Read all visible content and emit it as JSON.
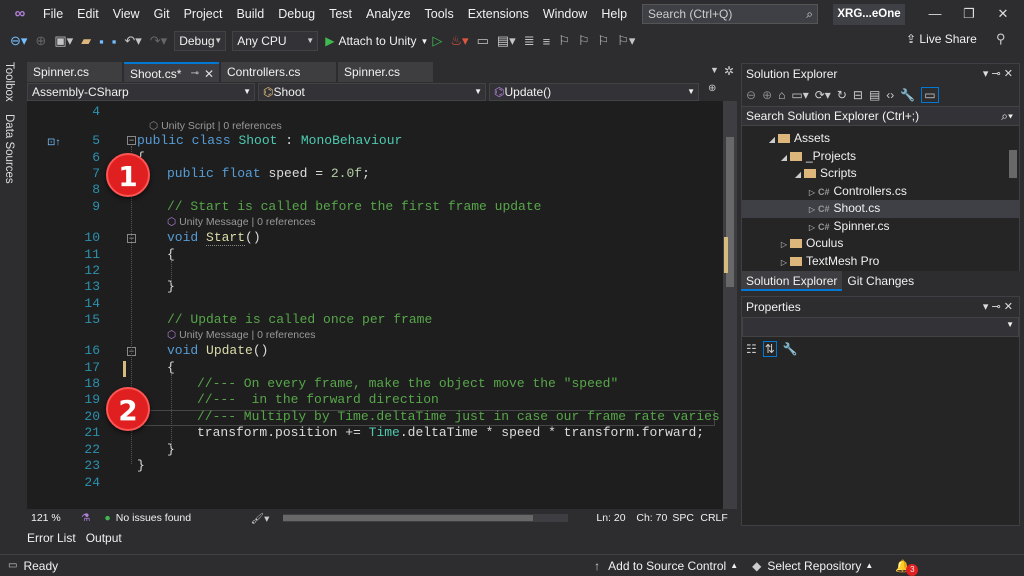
{
  "menu": [
    "File",
    "Edit",
    "View",
    "Git",
    "Project",
    "Build",
    "Debug",
    "Test",
    "Analyze",
    "Tools",
    "Extensions",
    "Window",
    "Help"
  ],
  "search": {
    "label": "Search (Ctrl+Q)"
  },
  "app_badge": "XRG...eOne",
  "toolbar": {
    "config": "Debug",
    "platform": "Any CPU",
    "attach": "Attach to Unity",
    "live_share": "Live Share"
  },
  "left_rail": [
    "Toolbox",
    "Data Sources"
  ],
  "doc_tabs": [
    "Spinner.cs",
    "Shoot.cs*",
    "Controllers.cs",
    "Spinner.cs"
  ],
  "navbar": {
    "project": "Assembly-CSharp",
    "class": "Shoot",
    "member": "Update()"
  },
  "code": {
    "n4": "4",
    "n5": "5",
    "n6": "6",
    "n7": "7",
    "n8": "8",
    "n9": "9",
    "n10": "10",
    "n11": "11",
    "n12": "12",
    "n13": "13",
    "n14": "14",
    "n15": "15",
    "n16": "16",
    "n17": "17",
    "n18": "18",
    "n19": "19",
    "n20": "20",
    "n21": "21",
    "n22": "22",
    "n23": "23",
    "n24": "24",
    "lens_class": "Unity Script | 0 references",
    "lens_start": "Unity Message | 0 references",
    "lens_update": "Unity Message | 0 references",
    "public": "public",
    "class": "class",
    "shoot": "Shoot",
    "colon": " : ",
    "mono": "MonoBehaviour",
    "brace_open": "{",
    "brace_close": "}",
    "float": "float",
    "speed_decl": " speed = ",
    "speed_val": "2.0f",
    "semi": ";",
    "c9": "// Start is called before the first frame update",
    "void": "void",
    "start": "Start",
    "parens": "()",
    "c15": "// Update is called once per frame",
    "update": "Update",
    "c18": "//--- On every frame, make the object move the \"speed\"",
    "c19": "//---  in the forward direction",
    "c20": "//--- Multiply by Time.deltaTime just in case our frame rate varies",
    "l21a": "transform.position += ",
    "l21b": "Time",
    "l21c": ".deltaTime * speed * transform.forward;"
  },
  "badges": [
    "1",
    "2"
  ],
  "editor_status": {
    "zoom": "121 %",
    "issues": "No issues found",
    "ln": "Ln: 20",
    "ch": "Ch: 70",
    "spc": "SPC",
    "crlf": "CRLF"
  },
  "bottom_tabs": [
    "Error List",
    "Output"
  ],
  "status": {
    "ready": "Ready",
    "add_source": "Add to Source Control",
    "select_repo": "Select Repository",
    "notif_count": "3"
  },
  "solution": {
    "title": "Solution Explorer",
    "search": "Search Solution Explorer (Ctrl+;)",
    "tree": [
      {
        "label": "Assets",
        "kind": "folder"
      },
      {
        "label": "_Projects",
        "kind": "folder"
      },
      {
        "label": "Scripts",
        "kind": "folder"
      },
      {
        "label": "Controllers.cs",
        "kind": "cs"
      },
      {
        "label": "Shoot.cs",
        "kind": "cs"
      },
      {
        "label": "Spinner.cs",
        "kind": "cs"
      },
      {
        "label": "Oculus",
        "kind": "folder"
      },
      {
        "label": "TextMesh Pro",
        "kind": "folder"
      }
    ],
    "tabs": [
      "Solution Explorer",
      "Git Changes"
    ]
  },
  "properties": {
    "title": "Properties"
  },
  "colors": {
    "accent": "#0078d4",
    "badge": "#e02020",
    "keyword": "#569cd6",
    "type": "#4ec9b0",
    "comment": "#57a64a"
  }
}
